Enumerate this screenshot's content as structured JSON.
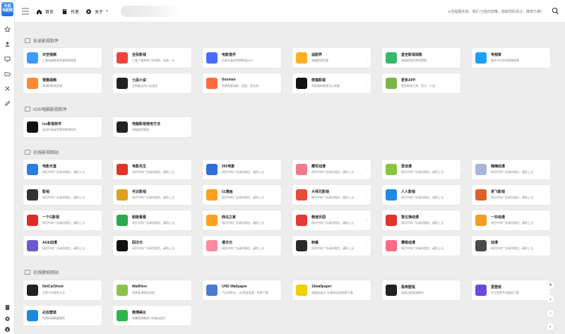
{
  "logo": {
    "line1": "大百",
    "line2": "导航网"
  },
  "header": {
    "nav": [
      {
        "label": "首页",
        "icon": "home-icon"
      },
      {
        "label": "作者",
        "icon": "book-icon"
      },
      {
        "label": "关于",
        "icon": "gear-icon"
      }
    ],
    "notice": "公告提醒无效，我们 已经向您推，感谢您的关注，推荐已满！"
  },
  "sections": [
    {
      "title": "安卓影视软件",
      "cards": [
        {
          "name": "天空视频",
          "desc": "汇集海量影视资源免费观看",
          "color": "#3d9bff"
        },
        {
          "name": "全民影视",
          "desc": "汇集了各种热门的电影、电视、动...",
          "color": "#f0433a"
        },
        {
          "name": "电影猎手",
          "desc": "资源丰富的免费影视APP",
          "color": "#4b6bff"
        },
        {
          "name": "追剧界",
          "desc": "海量影视资源",
          "color": "#ffb020"
        },
        {
          "name": "星空影视观影",
          "desc": "海量影视资源免费看",
          "color": "#34b86a"
        },
        {
          "name": "电视家",
          "desc": "超多节目在线直播观看",
          "color": "#1aa0ff"
        },
        {
          "name": "雪糕视频",
          "desc": "高清的影视资源",
          "color": "#ff8a2b"
        },
        {
          "name": "七层小说",
          "desc": "全网最全的小说阅读",
          "color": "#222"
        },
        {
          "name": "Souman",
          "desc": "免费观看电影、短剧、综艺和...",
          "color": "#ff6a3d"
        },
        {
          "name": "熊猫影视",
          "desc": "海量最新影视可以观看",
          "color": "#111"
        },
        {
          "name": "更多APP",
          "desc": "更多影视工具，音乐、小说...",
          "color": "#7ab648"
        }
      ]
    },
    {
      "title": "IOS/电脑影视软件",
      "cards": [
        {
          "name": "ios影视软件",
          "desc": "此网页收录苹果的影视软件",
          "color": "#111"
        },
        {
          "name": "电脑影视使用方法",
          "desc": "电脑使用教程",
          "color": "#222"
        }
      ]
    },
    {
      "title": "在线影视网站",
      "cards": [
        {
          "name": "电影天堂",
          "desc": "网页中的广告请勿相信，谨防上当",
          "color": "#2a7de1"
        },
        {
          "name": "电影先生",
          "desc": "网页中的广告请勿相信，谨防上当",
          "color": "#e0342b"
        },
        {
          "name": "555电影",
          "desc": "网页中的广告请勿相信，谨防上当",
          "color": "#2e6fd8"
        },
        {
          "name": "樱花动漫",
          "desc": "网页中的广告请勿相信，谨防上当",
          "color": "#f07a8a"
        },
        {
          "name": "爱动漫",
          "desc": "网页中的广告请勿相信，谨防上当",
          "color": "#8bc53f"
        },
        {
          "name": "嗨嗨动漫",
          "desc": "网页中的广告请勿相信，谨防上当",
          "color": "#aab4d8"
        },
        {
          "name": "影视",
          "desc": "网页中的广告请勿相信，谨防上当",
          "color": "#333"
        },
        {
          "name": "可达影视",
          "desc": "网页中的广告请勿相信，谨防上当",
          "color": "#e0a020"
        },
        {
          "name": "51漫画",
          "desc": "网页中的广告请勿相信，谨防上当",
          "color": "#ffa020"
        },
        {
          "name": "大师兄影视",
          "desc": "网页中的广告请勿相信，谨防上当",
          "color": "#e84a3a"
        },
        {
          "name": "人人影视",
          "desc": "网页中的广告请勿相信，谨防上当",
          "color": "#1d8ae8"
        },
        {
          "name": "茶飞影视",
          "desc": "网页中的广告请勿相信，谨防上当",
          "color": "#e0602a"
        },
        {
          "name": "一个G影视",
          "desc": "网页中的广告请勿相信，谨防上当",
          "color": "#e02a2a"
        },
        {
          "name": "剧能看看",
          "desc": "网页中的广告请勿相信，谨防上当",
          "color": "#2aa84a"
        },
        {
          "name": "西瓜之家",
          "desc": "网页中的广告请勿相信，谨防上当",
          "color": "#ffa020"
        },
        {
          "name": "韩迷乐园",
          "desc": "网页中的广告请勿相信，谨防上当",
          "color": "#e03a3a"
        },
        {
          "name": "第五弹动漫",
          "desc": "网页中的广告请勿相信，谨防上当",
          "color": "#e0342b"
        },
        {
          "name": "一抖动漫",
          "desc": "网页中的广告请勿相信，谨防上当",
          "color": "#f0a020"
        },
        {
          "name": "AGE动漫",
          "desc": "网页中的广告请勿相信，谨防上当",
          "color": "#6a5acd"
        },
        {
          "name": "囧次元",
          "desc": "网页中的广告请勿相信，谨防上当",
          "color": "#111"
        },
        {
          "name": "漫次元",
          "desc": "网页中的广告请勿相信，谨防上当",
          "color": "#ff8aa0"
        },
        {
          "name": "刺番",
          "desc": "网页中的广告请勿相信，谨防上当",
          "color": "#2a2a2a"
        },
        {
          "name": "樱桃动漫",
          "desc": "网页中的广告请勿相信，谨防上当",
          "color": "#ff6a8a"
        },
        {
          "name": "动漫",
          "desc": "网页中的广告请勿相信，谨防上当",
          "color": "#4a4a4a"
        }
      ]
    },
    {
      "title": "在线壁纸网站",
      "cards": [
        {
          "name": "NetCarShow",
          "desc": "世界汽车壁纸大全",
          "color": "#222"
        },
        {
          "name": "WallHere",
          "desc": "免费高清壁纸资源",
          "color": "#8bc34a"
        },
        {
          "name": "UHD Wallpaper",
          "desc": "汽车免费4K、8K壁纸资源，免费下载",
          "color": "#4a7bd0"
        },
        {
          "name": "10wallpaper",
          "desc": "海量高清4K 5K壁纸资源免费下载",
          "color": "#f0d000"
        },
        {
          "name": "极简壁纸",
          "desc": "极简风格高清壁纸",
          "color": "#222"
        },
        {
          "name": "爱壁纸",
          "desc": "专注免费手机壁纸下载",
          "color": "#6a4ae0"
        },
        {
          "name": "必应壁纸",
          "desc": "免费高清精美壁纸",
          "color": "#1a8ae0"
        },
        {
          "name": "微博美女",
          "desc": "收藏微博最热门的美女图片",
          "color": "#2ab84a"
        }
      ]
    }
  ]
}
